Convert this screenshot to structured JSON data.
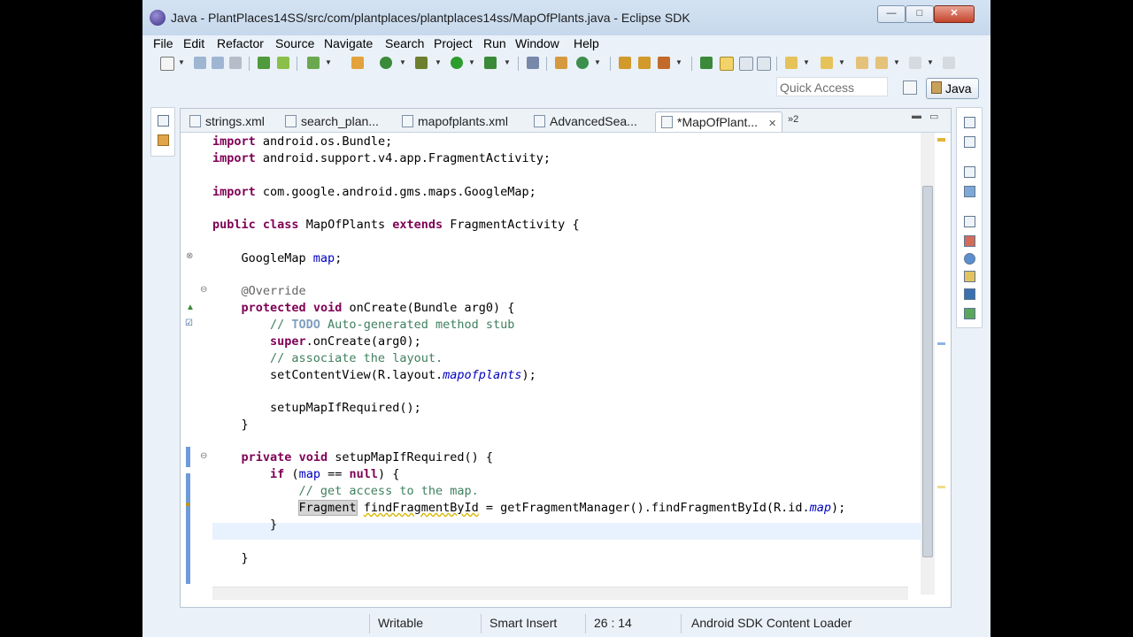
{
  "window": {
    "title": "Java - PlantPlaces14SS/src/com/plantplaces/plantplaces14ss/MapOfPlants.java - Eclipse SDK",
    "buttons": [
      "—",
      "□",
      "✕"
    ]
  },
  "menu": [
    "File",
    "Edit",
    "Refactor",
    "Source",
    "Navigate",
    "Search",
    "Project",
    "Run",
    "Window",
    "Help"
  ],
  "quick_access": {
    "placeholder": "Quick Access"
  },
  "perspective": {
    "label": "Java"
  },
  "tabs": [
    {
      "label": "strings.xml",
      "active": false
    },
    {
      "label": "search_plan...",
      "active": false
    },
    {
      "label": "mapofplants.xml",
      "active": false
    },
    {
      "label": "AdvancedSea...",
      "active": false
    },
    {
      "label": "*MapOfPlant...",
      "active": true
    }
  ],
  "tabs_overflow": "»2",
  "code": {
    "l1_kw": "import",
    "l1_rest": " android.os.Bundle;",
    "l2_kw": "import",
    "l2_rest": " android.support.v4.app.FragmentActivity;",
    "l3_kw": "import",
    "l3_rest": " com.google.android.gms.maps.GoogleMap;",
    "l4_kw1": "public",
    "l4_kw2": "class",
    "l4_name": " MapOfPlants ",
    "l4_kw3": "extends",
    "l4_rest": " FragmentActivity {",
    "l5_type": "    GoogleMap ",
    "l5_field": "map",
    "l5_end": ";",
    "l6_ann": "    @Override",
    "l7_kw1": "protected",
    "l7_kw2": "void",
    "l7_rest": " onCreate(Bundle arg0) {",
    "l8_a": "        // ",
    "l8_todo": "TODO",
    "l8_b": " Auto-generated method stub",
    "l9_kw": "super",
    "l9_rest": ".onCreate(arg0);",
    "l10": "        // associate the layout.",
    "l11_a": "        setContentView(R.layout.",
    "l11_field": "mapofplants",
    "l11_b": ");",
    "l12": "        setupMapIfRequired();",
    "l13": "    }",
    "l14_kw1": "private",
    "l14_kw2": "void",
    "l14_rest": " setupMapIfRequired() {",
    "l15_kw": "if",
    "l15_a": " (",
    "l15_field": "map",
    "l15_b": " == ",
    "l15_kw2": "null",
    "l15_c": ") {",
    "l16": "            // get access to the map.",
    "l17_type": "Fragment",
    "l17_var": "findFragmentById",
    "l17_a": " = getFragmentManager().findFragmentById(R.id.",
    "l17_field": "map",
    "l17_b": ");",
    "l18": "        }",
    "l19": "    }"
  },
  "status": {
    "writable": "Writable",
    "insert_mode": "Smart Insert",
    "position": "26 : 14",
    "task": "Android SDK Content Loader"
  }
}
